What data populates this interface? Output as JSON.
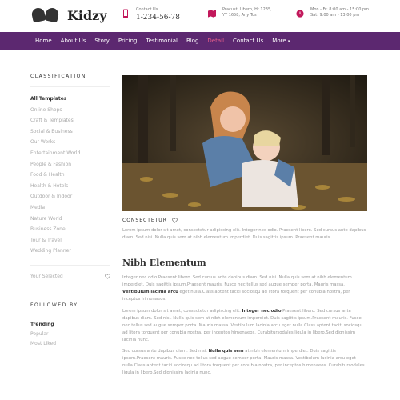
{
  "brand": {
    "name": "Kidzy"
  },
  "contact": {
    "phone_label": "Contact Us",
    "phone": "1-234-56-78",
    "address_line1": "Pracusti Libero, Ht 1235,",
    "address_line2": "YT 1658, Any Tos",
    "hours_line1": "Mon - Fr: 8:00 am - 15:00 pm",
    "hours_line2": "Sat: 9:00 am - 13:00 pm"
  },
  "nav": {
    "items": [
      "Home",
      "About Us",
      "Story",
      "Pricing",
      "Testimonial",
      "Blog",
      "Detail",
      "Contact Us",
      "More"
    ],
    "active": "Detail"
  },
  "sidebar": {
    "classification_heading": "CLASSIFICATION",
    "categories": [
      "All Templates",
      "Online Shops",
      "Craft & Templates",
      "Social & Business",
      "Our Works",
      "Entertainment World",
      "People & Fashion",
      "Food & Health",
      "Health & Hotels",
      "Outdoor & Indoor",
      "Media",
      "Nature World",
      "Business Zone",
      "Tour & Travel",
      "Wedding Planner"
    ],
    "your_selected": "Your Selected",
    "followed_heading": "FOLLOWED BY",
    "followed_items": [
      "Trending",
      "Popular",
      "Most Liked"
    ]
  },
  "post": {
    "tag": "CONSECTETUR",
    "intro": "Lorem ipsum dolor sit amet, consectetur adipiscing elit. Integer nec odio. Praesent libero. Sed cursus ante dapibus diam. Sed nisi. Nulla quis sem at nibh elementum imperdiet. Duis sagittis ipsum. Praesent mauris.",
    "section_title": "Nibh Elementum",
    "p2_a": "Integer nec odio.Praesent libero. Sed cursus ante dapibus diam. Sed nisi. Nulla quis sem at nibh elementum imperdiet. Duis sagittis ipsum.Praesent mauris. Fusce nec tellus sed augue semper porta. Mauris massa. ",
    "p2_bold": "Vestibulum lacinia arcu",
    "p2_b": " eget nulla.Class aptent taciti sociosqu ad litora torquent per conubia nostra, per inceptos himenaeos.",
    "p3_a": "Lorem ipsum dolor sit amet, consectetur adipiscing elit. ",
    "p3_bold": "Integer nec odio",
    "p3_b": " Praesent libero. Sed cursus ante dapibus diam. Sed nisi. Nulla quis sem at nibh elementum imperdiet. Duis sagittis ipsum.Praesent mauris. Fusce nec tellus sed augue semper porta. Mauris massa. Vestibulum lacinia arcu eget nulla.Class aptent taciti sociosqu ad litora torquent per conubia nostra, per inceptos himenaeos. Curabitursodales ligula in libero.Sed dignissim lacinia nunc.",
    "p4_a": "Sed cursus ante dapibus diam. Sed nisi. ",
    "p4_bold": "Nulla quis sem",
    "p4_b": " at nibh elementum imperdiet. Duis sagittis ipsum.Praesent mauris. Fusce nec tellus sed augue semper porta. Mauris massa. Vestibulum lacinia arcu eget nulla.Class aptent taciti sociosqu ad litora torquent per conubia nostra, per inceptos himenaeos. Curabitursodales ligula in libero.Sed dignissim lacinia nunc."
  },
  "colors": {
    "nav_bg": "#5c2870",
    "accent": "#e65c8a"
  }
}
